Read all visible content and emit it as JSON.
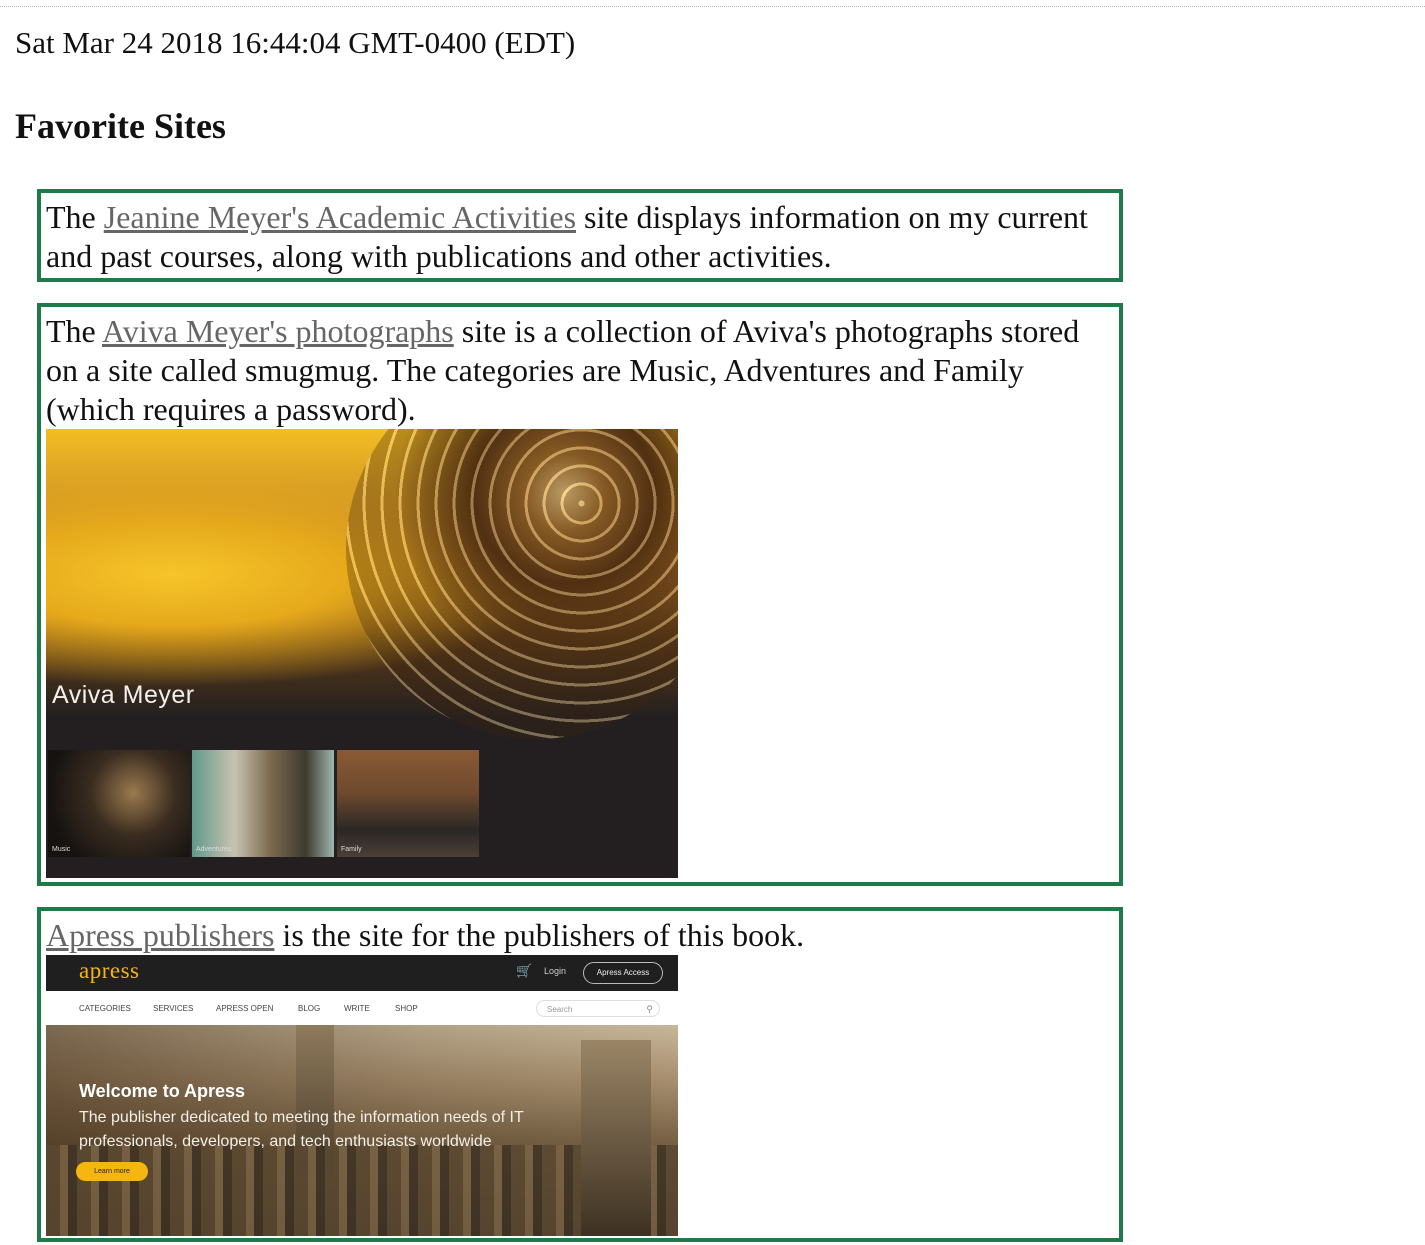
{
  "timestamp": "Sat Mar 24 2018 16:44:04 GMT-0400 (EDT)",
  "heading": "Favorite Sites",
  "colors": {
    "box_border": "#1f7a4a",
    "link": "#666666",
    "apress_accent": "#f5b60f"
  },
  "sites": [
    {
      "prefix": "The ",
      "link_text": "Jeanine Meyer's Academic Activities",
      "suffix": " site displays information on my current and past courses, along with publications and other activities."
    },
    {
      "prefix": "The ",
      "link_text": "Aviva Meyer's photographs",
      "suffix": " site is a collection of Aviva's photographs stored on a site called smugmug. The categories are Music, Adventures and Family (which requires a password).",
      "image": {
        "title": "Aviva Meyer",
        "galleries": [
          "Music",
          "Adventures",
          "Family"
        ]
      }
    },
    {
      "prefix": "",
      "link_text": "Apress publishers",
      "suffix": " is the site for the publishers of this book.",
      "image": {
        "logo": "apress",
        "login": "Login",
        "access_button": "Apress Access",
        "nav": [
          "CATEGORIES",
          "SERVICES",
          "APRESS OPEN",
          "BLOG",
          "WRITE",
          "SHOP"
        ],
        "search_placeholder": "Search",
        "hero_title": "Welcome to Apress",
        "hero_text": "The publisher dedicated to meeting the information needs of IT professionals, developers, and tech enthusiasts worldwide",
        "cta": "Learn more",
        "icons": {
          "cart": "cart-icon",
          "search": "search-icon"
        }
      }
    }
  ]
}
